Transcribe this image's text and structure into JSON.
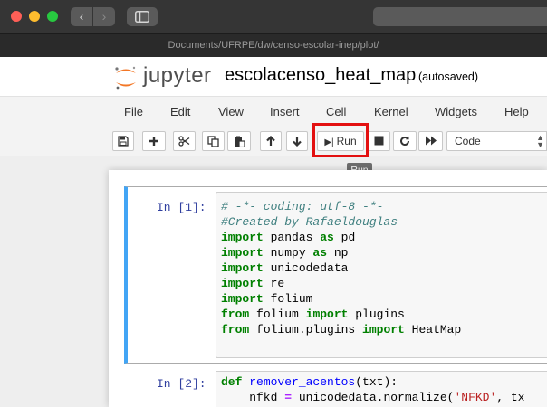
{
  "browser": {
    "path": "Documents/UFRPE/dw/censo-escolar-inep/plot/",
    "back_icon": "‹",
    "forward_icon": "›"
  },
  "header": {
    "logo_text": "jupyter",
    "notebook_name": "escolacenso_heat_map",
    "save_status": "(autosaved)"
  },
  "menu": [
    "File",
    "Edit",
    "View",
    "Insert",
    "Cell",
    "Kernel",
    "Widgets",
    "Help"
  ],
  "toolbar": {
    "run_label": "Run",
    "cell_type": "Code",
    "tooltip": "Run"
  },
  "colors": {
    "selected_cell_border": "#42a5f5",
    "run_highlight": "#e31010"
  },
  "cells": [
    {
      "prompt": "In [1]:",
      "lines": [
        [
          {
            "t": "# -*- coding: utf-8 -*-",
            "c": "cm"
          }
        ],
        [
          {
            "t": "#Created by Rafaeldouglas",
            "c": "cm"
          }
        ],
        [
          {
            "t": "import",
            "c": "kw"
          },
          {
            "t": " pandas ",
            "c": ""
          },
          {
            "t": "as",
            "c": "kw"
          },
          {
            "t": " pd",
            "c": ""
          }
        ],
        [
          {
            "t": "import",
            "c": "kw"
          },
          {
            "t": " numpy ",
            "c": ""
          },
          {
            "t": "as",
            "c": "kw"
          },
          {
            "t": " np",
            "c": ""
          }
        ],
        [
          {
            "t": "import",
            "c": "kw"
          },
          {
            "t": " unicodedata",
            "c": ""
          }
        ],
        [
          {
            "t": "import",
            "c": "kw"
          },
          {
            "t": " re",
            "c": ""
          }
        ],
        [
          {
            "t": "import",
            "c": "kw"
          },
          {
            "t": " folium",
            "c": ""
          }
        ],
        [
          {
            "t": "from",
            "c": "kw"
          },
          {
            "t": " folium ",
            "c": ""
          },
          {
            "t": "import",
            "c": "kw"
          },
          {
            "t": " plugins",
            "c": ""
          }
        ],
        [
          {
            "t": "from",
            "c": "kw"
          },
          {
            "t": " folium.plugins ",
            "c": ""
          },
          {
            "t": "import",
            "c": "kw"
          },
          {
            "t": " HeatMap",
            "c": ""
          }
        ]
      ]
    },
    {
      "prompt": "In [2]:",
      "lines": [
        [
          {
            "t": "def",
            "c": "kw"
          },
          {
            "t": " ",
            "c": ""
          },
          {
            "t": "remover_acentos",
            "c": "fn"
          },
          {
            "t": "(txt):",
            "c": ""
          }
        ],
        [
          {
            "t": "    nfkd ",
            "c": ""
          },
          {
            "t": "=",
            "c": "op"
          },
          {
            "t": " unicodedata.normalize(",
            "c": ""
          },
          {
            "t": "'NFKD'",
            "c": "st"
          },
          {
            "t": ", tx",
            "c": ""
          }
        ]
      ]
    }
  ]
}
